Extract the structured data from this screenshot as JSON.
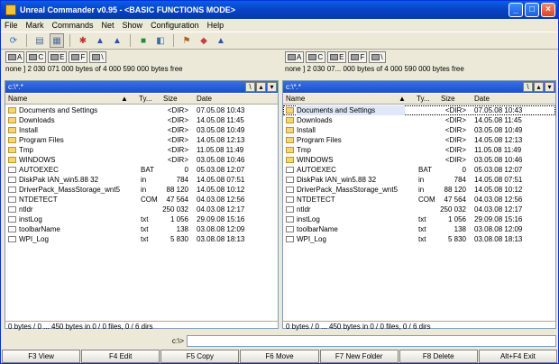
{
  "window": {
    "title": "Unreal Commander v0.95 - <BASIC FUNCTIONS MODE>",
    "min": "_",
    "max": "□",
    "close": "×"
  },
  "menu": [
    "File",
    "Mark",
    "Commands",
    "Net",
    "Show",
    "Configuration",
    "Help"
  ],
  "toolbar_icons": [
    "refresh-icon",
    "brief-view-icon",
    "full-view-icon",
    "sort-icon",
    "tree-icon",
    "tree-icon",
    "pack-icon",
    "unpack-icon",
    "find-icon",
    "ftp-icon",
    "ftp-icon"
  ],
  "drives": [
    {
      "letter": "A"
    },
    {
      "letter": "C"
    },
    {
      "letter": "E"
    },
    {
      "letter": "F"
    },
    {
      "letter": "\\"
    }
  ],
  "left": {
    "free": "none ] 2 030 071 000 bytes of 4 000 590 000 bytes free",
    "path": "c:\\*.*",
    "columns": {
      "name": "Name",
      "type": "Ty...",
      "size": "Size",
      "date": "Date"
    },
    "status": "0 bytes / 0 ... 450 bytes in 0 / 0 files, 0 / 6 dirs"
  },
  "right": {
    "free": "none ] 2 030 07... 000 bytes of 4 000 590 000 bytes free",
    "path": "c:\\*.*",
    "columns": {
      "name": "Name",
      "type": "Ty...",
      "size": "Size",
      "date": "Date"
    },
    "status": "0 bytes / 0 ... 450 bytes in 0 / 0 files, 0 / 6 dirs"
  },
  "files": [
    {
      "name": "Documents and Settings",
      "ext": "",
      "size": "<DIR>",
      "date": "07.05.08 10:43",
      "dir": true
    },
    {
      "name": "Downloads",
      "ext": "",
      "size": "<DIR>",
      "date": "14.05.08 11:45",
      "dir": true
    },
    {
      "name": "Install",
      "ext": "",
      "size": "<DIR>",
      "date": "03.05.08 10:49",
      "dir": true
    },
    {
      "name": "Program Files",
      "ext": "",
      "size": "<DIR>",
      "date": "14.05.08 12:13",
      "dir": true
    },
    {
      "name": "Tmp",
      "ext": "",
      "size": "<DIR>",
      "date": "11.05.08 11:49",
      "dir": true
    },
    {
      "name": "WINDOWS",
      "ext": "",
      "size": "<DIR>",
      "date": "03.05.08 10:46",
      "dir": true
    },
    {
      "name": "AUTOEXEC",
      "ext": "BAT",
      "size": "0",
      "date": "05.03.08 12:07",
      "dir": false
    },
    {
      "name": "DiskPak IAN_win5.88 32",
      "ext": "in",
      "size": "784",
      "date": "14.05.08 07:51",
      "dir": false
    },
    {
      "name": "DriverPack_MassStorage_wnt5",
      "ext": "in",
      "size": "88 120",
      "date": "14.05.08 10:12",
      "dir": false
    },
    {
      "name": "NTDETECT",
      "ext": "COM",
      "size": "47 564",
      "date": "04.03.08 12:56",
      "dir": false
    },
    {
      "name": "ntldr",
      "ext": "",
      "size": "250 032",
      "date": "04.03.08 12:17",
      "dir": false
    },
    {
      "name": "instLog",
      "ext": "txt",
      "size": "1 056",
      "date": "29.09.08 15:16",
      "dir": false
    },
    {
      "name": "toolbarName",
      "ext": "txt",
      "size": "138",
      "date": "03.08.08 12:09",
      "dir": false
    },
    {
      "name": "WPI_Log",
      "ext": "txt",
      "size": "5 830",
      "date": "03.08.08 18:13",
      "dir": false
    }
  ],
  "cmdline": {
    "prompt": "c:\\>"
  },
  "fkeys": [
    "F3 View",
    "F4 Edit",
    "F5 Copy",
    "F6 Move",
    "F7 New Folder",
    "F8 Delete",
    "Alt+F4 Exit"
  ]
}
